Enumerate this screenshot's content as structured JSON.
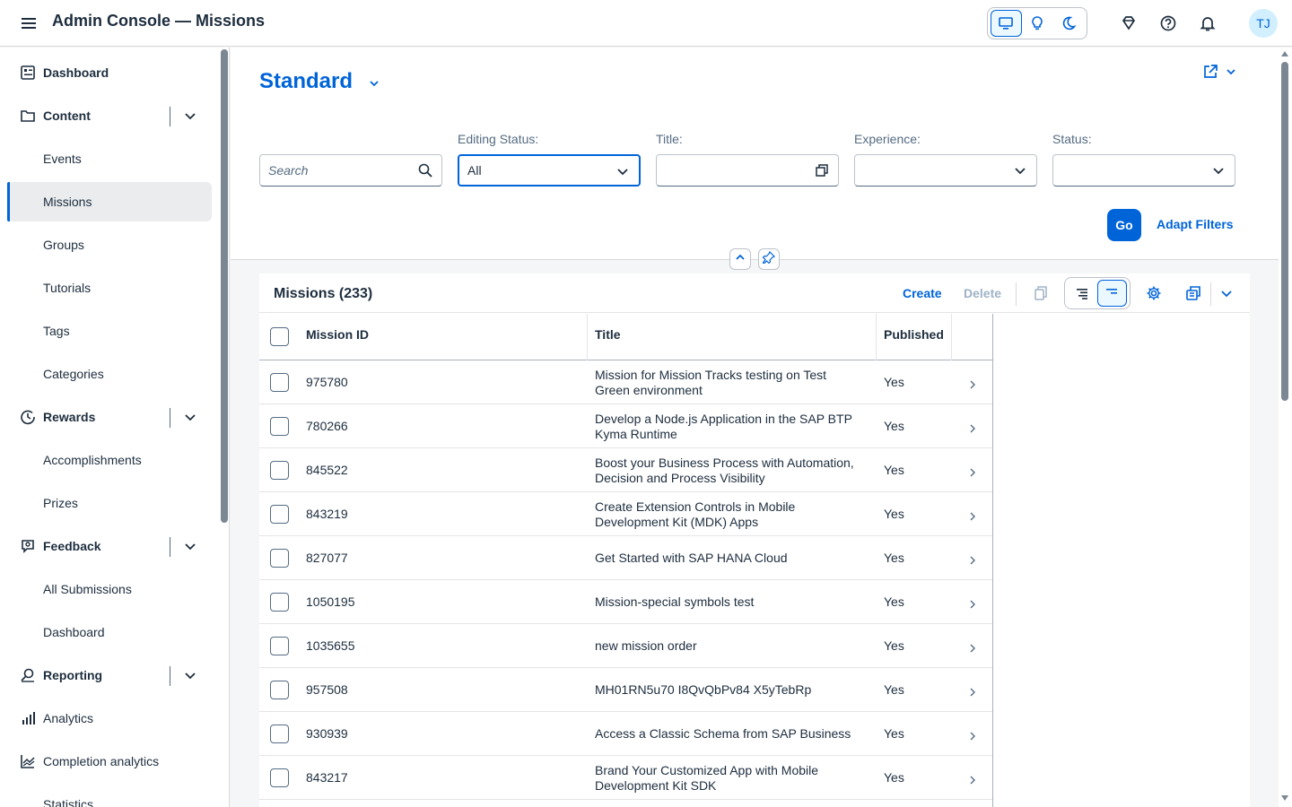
{
  "header": {
    "title": "Admin Console — Missions",
    "avatar_initials": "TJ",
    "icons": [
      "menu-icon",
      "desktop-icon",
      "lightbulb-icon",
      "moon-icon",
      "diamond-icon",
      "help-icon",
      "bell-icon"
    ]
  },
  "sidebar": {
    "items": [
      {
        "label": "Dashboard",
        "type": "group",
        "icon": "dashboard-icon"
      },
      {
        "label": "Content",
        "type": "group",
        "icon": "folder-icon",
        "expandable": true
      },
      {
        "label": "Events",
        "type": "child"
      },
      {
        "label": "Missions",
        "type": "child",
        "selected": true
      },
      {
        "label": "Groups",
        "type": "child"
      },
      {
        "label": "Tutorials",
        "type": "child"
      },
      {
        "label": "Tags",
        "type": "child"
      },
      {
        "label": "Categories",
        "type": "child"
      },
      {
        "label": "Rewards",
        "type": "group",
        "icon": "rewards-icon",
        "expandable": true
      },
      {
        "label": "Accomplishments",
        "type": "child"
      },
      {
        "label": "Prizes",
        "type": "child"
      },
      {
        "label": "Feedback",
        "type": "group",
        "icon": "feedback-icon",
        "expandable": true
      },
      {
        "label": "All Submissions",
        "type": "child"
      },
      {
        "label": "Dashboard",
        "type": "child"
      },
      {
        "label": "Reporting",
        "type": "group",
        "icon": "reporting-icon",
        "expandable": true
      },
      {
        "label": "Analytics",
        "type": "sub",
        "icon": "bar-chart-icon"
      },
      {
        "label": "Completion analytics",
        "type": "sub",
        "icon": "line-chart-icon"
      },
      {
        "label": "Statistics",
        "type": "child"
      }
    ]
  },
  "filters": {
    "variant": "Standard",
    "search_placeholder": "Search",
    "editing_status_label": "Editing Status:",
    "editing_status_value": "All",
    "title_label": "Title:",
    "experience_label": "Experience:",
    "status_label": "Status:",
    "go_label": "Go",
    "adapt_label": "Adapt Filters"
  },
  "table": {
    "title": "Missions (233)",
    "create_label": "Create",
    "delete_label": "Delete",
    "columns": [
      "Mission ID",
      "Title",
      "Published"
    ],
    "rows": [
      {
        "id": "975780",
        "title": "Mission for Mission Tracks testing on Test Green environment",
        "published": "Yes"
      },
      {
        "id": "780266",
        "title": "Develop a Node.js Application in the SAP BTP Kyma Runtime",
        "published": "Yes"
      },
      {
        "id": "845522",
        "title": "Boost your Business Process with Automation, Decision and Process Visibility",
        "published": "Yes"
      },
      {
        "id": "843219",
        "title": "Create Extension Controls in Mobile Development Kit (MDK) Apps",
        "published": "Yes"
      },
      {
        "id": "827077",
        "title": "Get Started with SAP HANA Cloud",
        "published": "Yes"
      },
      {
        "id": "1050195",
        "title": "Mission-special symbols test",
        "published": "Yes"
      },
      {
        "id": "1035655",
        "title": "new mission order",
        "published": "Yes"
      },
      {
        "id": "957508",
        "title": "MH01RN5u70 I8QvQbPv84 X5yTebRp",
        "published": "Yes"
      },
      {
        "id": "930939",
        "title": "Access a Classic Schema from SAP Business",
        "published": "Yes"
      },
      {
        "id": "843217",
        "title": "Brand Your Customized App with Mobile Development Kit SDK",
        "published": "Yes"
      }
    ]
  },
  "colors": {
    "accent": "#0064d9",
    "text": "#1d2d3e",
    "muted": "#556b82"
  }
}
